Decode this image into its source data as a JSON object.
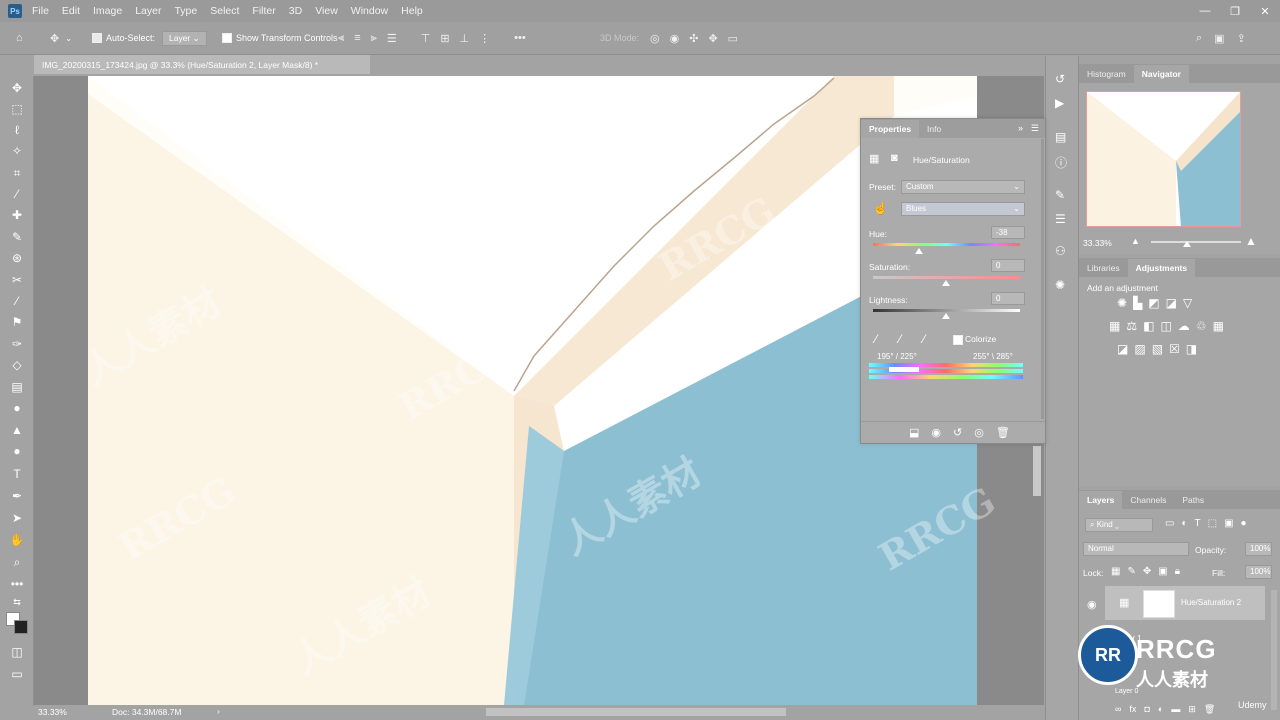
{
  "app": {
    "logo_text": "Ps"
  },
  "menu": [
    "File",
    "Edit",
    "Image",
    "Layer",
    "Type",
    "Select",
    "Filter",
    "3D",
    "View",
    "Window",
    "Help"
  ],
  "window_controls": {
    "minimize": "—",
    "restore": "❐",
    "close": "✕"
  },
  "options_bar": {
    "auto_select_label": "Auto-Select:",
    "auto_select_target": "Layer",
    "show_transform_label": "Show Transform Controls",
    "mode_3d_label": "3D Mode:"
  },
  "document_tab": {
    "title": "IMG_20200315_173424.jpg @ 33.3% (Hue/Saturation 2, Layer Mask/8) *"
  },
  "status_bar": {
    "zoom": "33.33%",
    "doc_size": "Doc: 34.3M/68.7M"
  },
  "properties_panel": {
    "tabs": [
      "Properties",
      "Info"
    ],
    "title": "Hue/Saturation",
    "preset_label": "Preset:",
    "preset_value": "Custom",
    "channel_value": "Blues",
    "hue_label": "Hue:",
    "hue_value": "-38",
    "saturation_label": "Saturation:",
    "saturation_value": "0",
    "lightness_label": "Lightness:",
    "lightness_value": "0",
    "colorize_label": "Colorize",
    "range_left": "195° / 225°",
    "range_right": "255° \\ 285°"
  },
  "navigator_panel": {
    "tabs": [
      "Histogram",
      "Navigator"
    ],
    "zoom": "33.33%"
  },
  "adjustments_panel": {
    "tabs": [
      "Libraries",
      "Adjustments"
    ],
    "add_label": "Add an adjustment"
  },
  "layers_panel": {
    "tabs": [
      "Layers",
      "Channels",
      "Paths"
    ],
    "filter_kind": "Kind",
    "blend_mode": "Normal",
    "opacity_label": "Opacity:",
    "opacity_value": "100%",
    "lock_label": "Lock:",
    "fill_label": "Fill:",
    "fill_value": "100%",
    "layers": [
      {
        "name": "Hue/Saturation 2"
      },
      {
        "name": "Layer 1"
      },
      {
        "name": "Layer 0"
      }
    ],
    "footer_fx": "fx"
  },
  "watermarks": {
    "text_latin": "RRCG",
    "text_cn": "人人素材",
    "udemy": "Udemy"
  },
  "colors": {
    "accent_blue": "#8dbfd3",
    "wall_cream": "#fbf3e3",
    "ui_gray": "#a3a3a3"
  }
}
